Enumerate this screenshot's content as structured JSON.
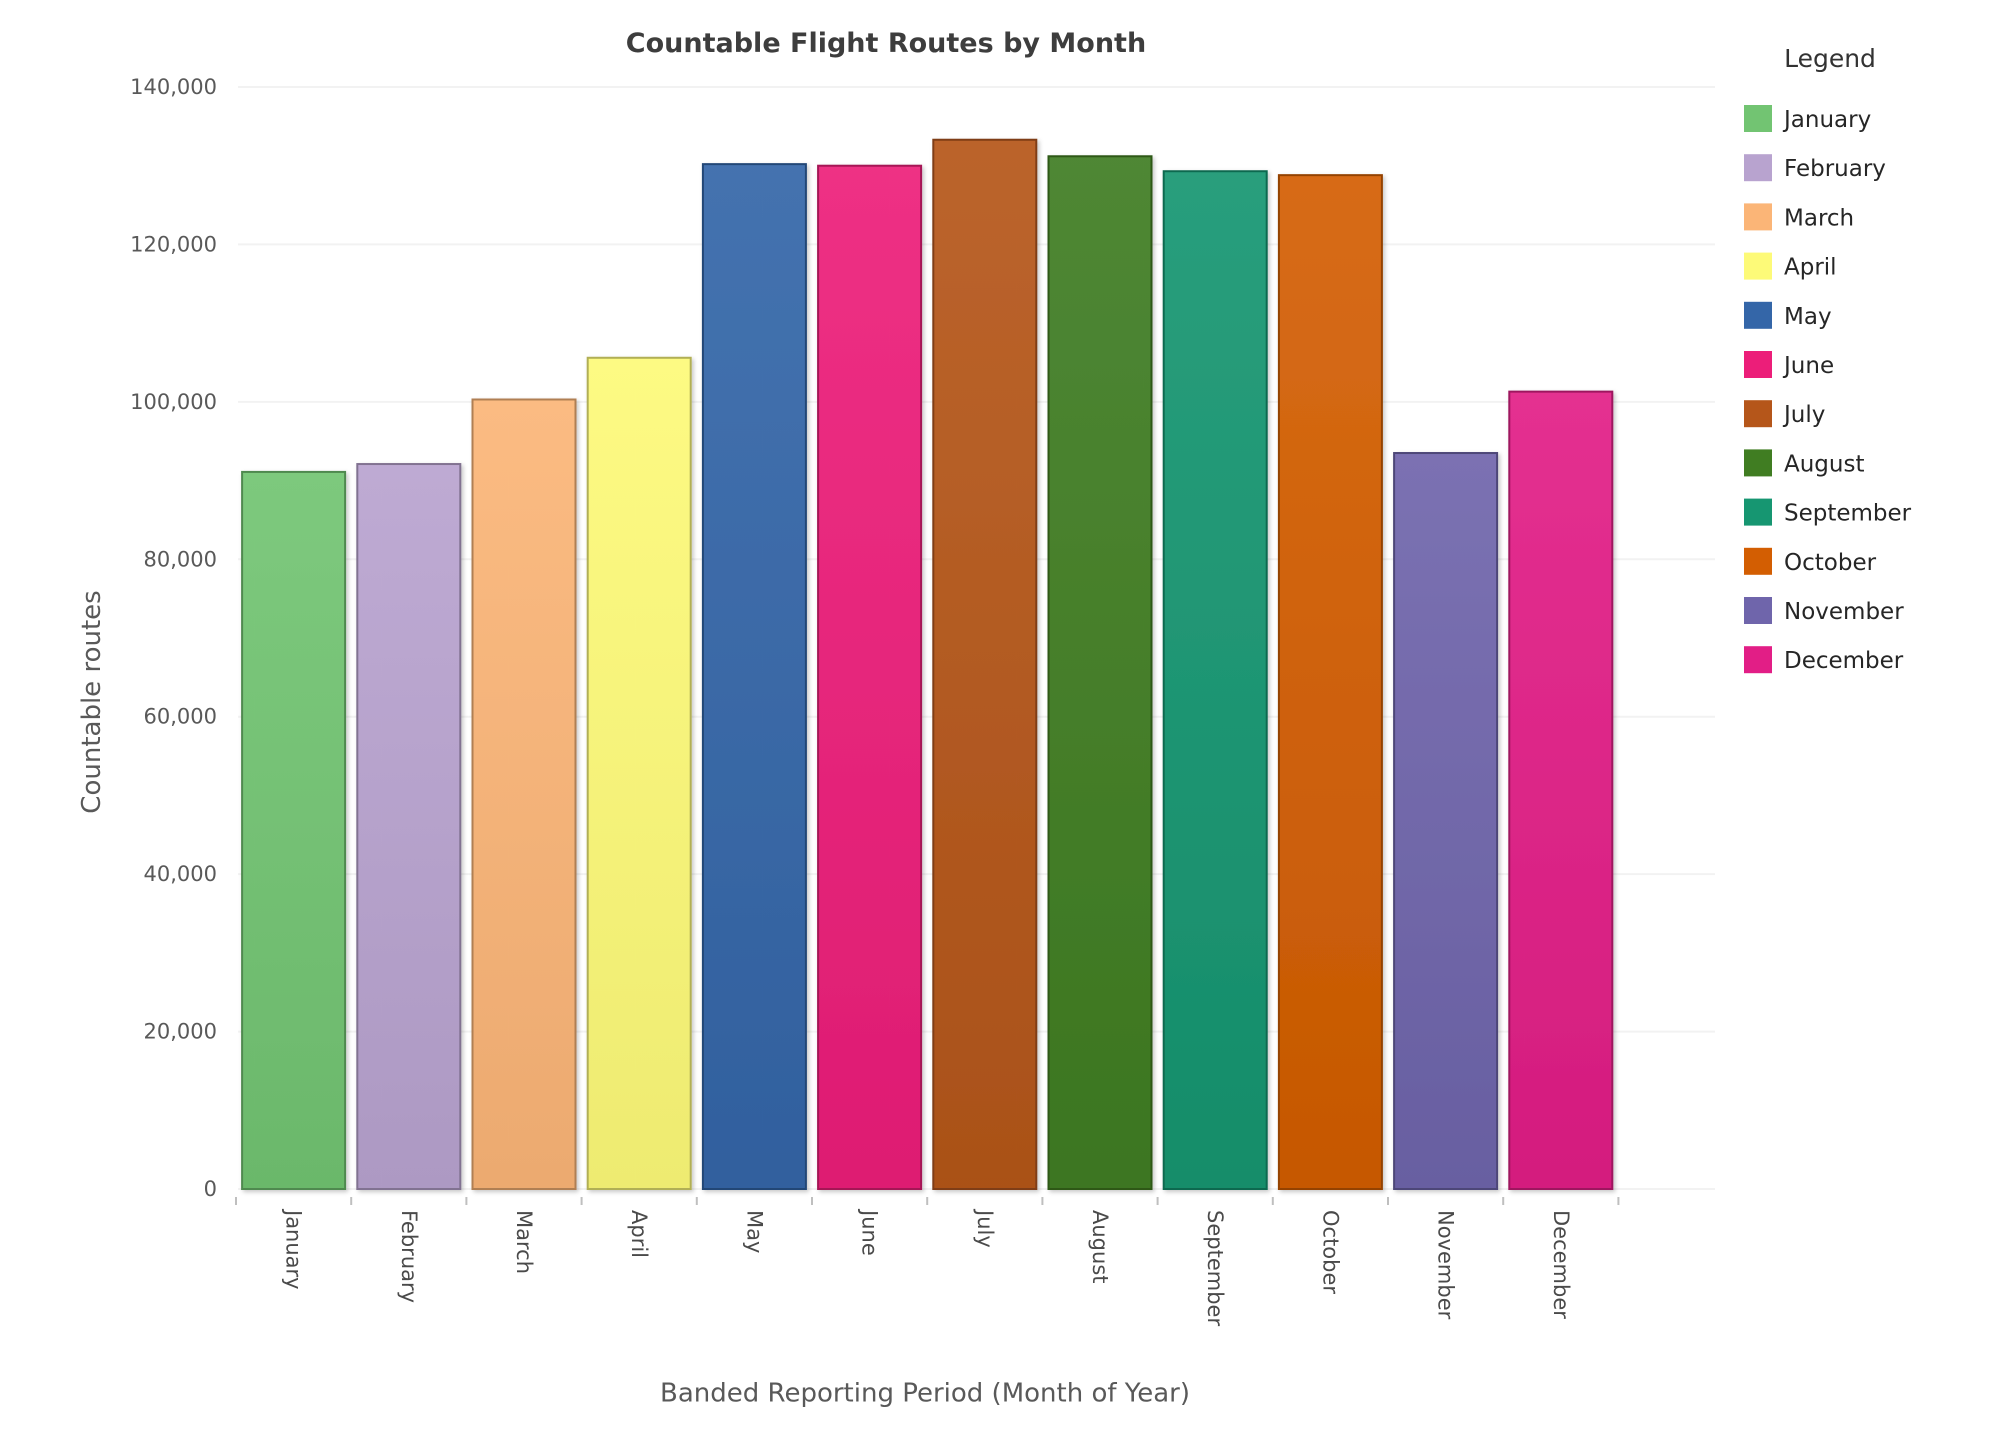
{
  "chart_data": {
    "type": "bar",
    "title": "Countable Flight Routes by Month",
    "xlabel": "Banded Reporting Period (Month of Year)",
    "ylabel": "Countable routes",
    "ylim": [
      0,
      140000
    ],
    "yticks": [
      0,
      20000,
      40000,
      60000,
      80000,
      100000,
      120000,
      140000
    ],
    "ytick_labels": [
      "0",
      "20,000",
      "40,000",
      "60,000",
      "80,000",
      "100,000",
      "120,000",
      "140,000"
    ],
    "grid": true,
    "legend_title": "Legend",
    "legend_position": "right",
    "categories": [
      "January",
      "February",
      "March",
      "April",
      "May",
      "June",
      "July",
      "August",
      "September",
      "October",
      "November",
      "December"
    ],
    "values": [
      91100,
      92100,
      100300,
      105600,
      130200,
      130000,
      133300,
      131200,
      129300,
      128800,
      93500,
      101300
    ],
    "colors": [
      "#72c472",
      "#b8a3cf",
      "#fbb577",
      "#fdfa78",
      "#3466a8",
      "#ec1e79",
      "#b5561a",
      "#407d22",
      "#169671",
      "#d35e02",
      "#6f65ab",
      "#e21e86"
    ]
  }
}
